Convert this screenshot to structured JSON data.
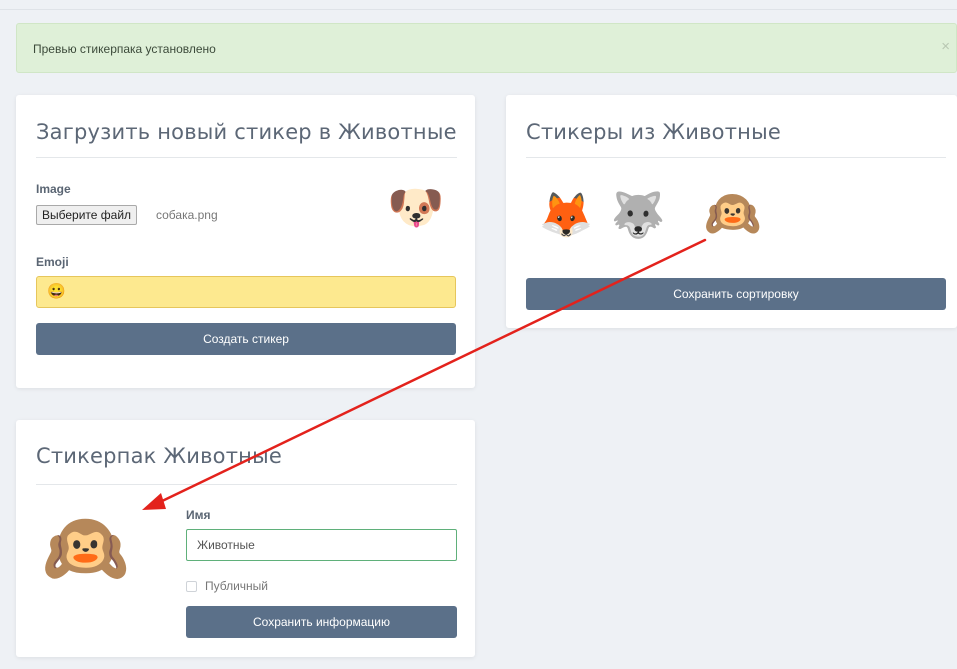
{
  "alert": {
    "message": "Превью стикерпака установлено",
    "close": "×"
  },
  "upload_card": {
    "title": "Загрузить новый стикер в Животные",
    "image_label": "Image",
    "file_button": "Выберите файл",
    "file_name": "собака.png",
    "preview_emoji": "🐶",
    "emoji_label": "Emoji",
    "emoji_value": "😀",
    "submit_label": "Создать стикер"
  },
  "stickers_card": {
    "title": "Стикеры из Животные",
    "stickers": [
      "🦊",
      "🐺",
      "🙉"
    ],
    "save_sort_label": "Сохранить сортировку"
  },
  "pack_card": {
    "title": "Стикерпак Животные",
    "preview_emoji": "🙉",
    "name_label": "Имя",
    "name_value": "Животные",
    "public_label": "Публичный",
    "public_checked": false,
    "save_info_label": "Сохранить информацию"
  },
  "colors": {
    "alert_bg": "#dff0d8",
    "button_bg": "#5b7089",
    "emoji_field_bg": "#fde98f",
    "arrow": "#e3221c"
  }
}
